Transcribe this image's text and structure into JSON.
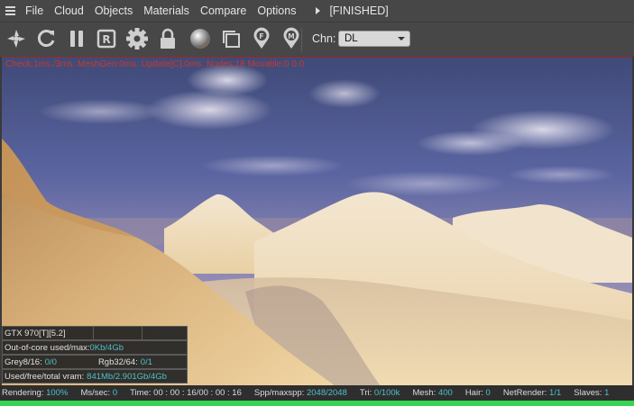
{
  "menubar": {
    "items": [
      "File",
      "Cloud",
      "Objects",
      "Materials",
      "Compare",
      "Options"
    ],
    "status": "[FINISHED]"
  },
  "toolbar": {
    "icons": [
      "reset-camera-icon",
      "restart-icon",
      "pause-icon",
      "region-render-icon",
      "settings-gear-icon",
      "lock-icon",
      "material-sphere-icon",
      "focus-frame-icon",
      "focus-pick-icon",
      "material-pick-icon"
    ],
    "channel_label": "Chn:",
    "channel_value": "DL"
  },
  "viewport": {
    "overlay": "Check:1ms./3ms. MeshGen:0ms. Update[C]:0ms. Nodes:18 Movable:0  0 0"
  },
  "info": {
    "gpu": "GTX 970[T][5.2]",
    "out_of_core_label": "Out-of-core used/max:",
    "out_of_core_value": "0Kb/4Gb",
    "grey_label": "Grey8/16:",
    "grey_value": "0/0",
    "rgb_label": "Rgb32/64:",
    "rgb_value": "0/1",
    "vram_label": "Used/free/total vram:",
    "vram_value": "841Mb/2.901Gb/4Gb"
  },
  "statusbar": {
    "rendering_label": "Rendering:",
    "rendering_value": "100%",
    "mssec_label": "Ms/sec:",
    "mssec_value": "0",
    "time_label": "Time:",
    "time_value": "00 : 00 : 16/00 : 00 : 16",
    "spp_label": "Spp/maxspp:",
    "spp_value": "2048/2048",
    "tri_label": "Tri:",
    "tri_value": "0/100k",
    "mesh_label": "Mesh:",
    "mesh_value": "400",
    "hair_label": "Hair:",
    "hair_value": "0",
    "netrender_label": "NetRender:",
    "netrender_value": "1/1",
    "slaves_label": "Slaves:",
    "slaves_value": "1"
  },
  "progress": {
    "fraction": 1.0
  },
  "colors": {
    "accent_value": "#4fc0c8",
    "progress": "#39d353",
    "overlay_text": "#c83a2a"
  }
}
